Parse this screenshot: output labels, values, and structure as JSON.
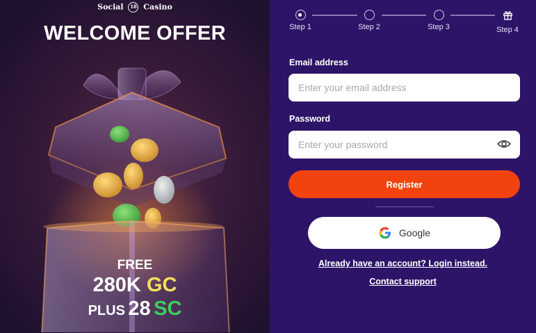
{
  "promo": {
    "logo_left": "Social",
    "logo_badge": "18",
    "logo_right": "Casino",
    "title": "WELCOME OFFER",
    "free_label": "FREE",
    "gc_amount": "280K",
    "gc_label": "GC",
    "plus_label": "PLUS",
    "sc_amount": "28",
    "sc_label": "SC",
    "colors": {
      "gc": "#f7e05a",
      "sc": "#3ccf5a"
    }
  },
  "stepper": {
    "current_step": 1,
    "steps": [
      {
        "label": "Step 1",
        "icon": "radio-active-icon"
      },
      {
        "label": "Step 2",
        "icon": "radio-empty-icon"
      },
      {
        "label": "Step 3",
        "icon": "radio-empty-icon"
      },
      {
        "label": "Step 4",
        "icon": "gift-icon"
      }
    ]
  },
  "form": {
    "email_label": "Email address",
    "email_placeholder": "Enter your email address",
    "email_value": "",
    "password_label": "Password",
    "password_placeholder": "Enter your password",
    "password_value": "",
    "password_toggle_icon": "eye-icon",
    "register_label": "Register",
    "register_color": "#f2430f",
    "google_label": "Google",
    "login_link": "Already have an account? Login instead.",
    "support_link": "Contact support"
  }
}
